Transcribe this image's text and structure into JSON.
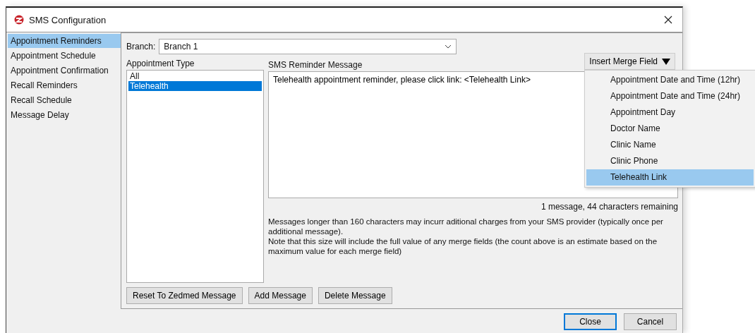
{
  "window": {
    "title": "SMS Configuration"
  },
  "sidebar": {
    "items": [
      {
        "label": "Appointment Reminders",
        "selected": true
      },
      {
        "label": "Appointment Schedule",
        "selected": false
      },
      {
        "label": "Appointment Confirmation",
        "selected": false
      },
      {
        "label": "Recall Reminders",
        "selected": false
      },
      {
        "label": "Recall Schedule",
        "selected": false
      },
      {
        "label": "Message Delay",
        "selected": false
      }
    ]
  },
  "branch": {
    "label": "Branch:",
    "value": "Branch 1"
  },
  "appointment_type": {
    "label": "Appointment Type",
    "items": [
      {
        "label": "All",
        "selected": false
      },
      {
        "label": "Telehealth",
        "selected": true
      }
    ]
  },
  "message": {
    "label": "SMS Reminder Message",
    "value": "Telehealth appointment reminder, please click link: <Telehealth Link>",
    "counter": "1 message, 44 characters remaining",
    "notes": [
      "Messages longer than 160 characters may incurr aditional charges from your SMS provider (typically once per additional message).",
      "Note that this size will include the full value of any merge fields (the count above is an estimate based on the maximum value for each merge field)"
    ]
  },
  "merge_field": {
    "label": "Insert Merge Field",
    "menu": [
      {
        "label": "Appointment Date and Time (12hr)",
        "selected": false
      },
      {
        "label": "Appointment Date and Time (24hr)",
        "selected": false
      },
      {
        "label": "Appointment Day",
        "selected": false
      },
      {
        "label": "Doctor Name",
        "selected": false
      },
      {
        "label": "Clinic Name",
        "selected": false
      },
      {
        "label": "Clinic Phone",
        "selected": false
      },
      {
        "label": "Telehealth Link",
        "selected": true
      }
    ]
  },
  "panel_buttons": [
    "Reset To Zedmed Message",
    "Add Message",
    "Delete Message"
  ],
  "dialog_buttons": [
    {
      "label": "Close",
      "default": true
    },
    {
      "label": "Cancel",
      "default": false
    }
  ]
}
